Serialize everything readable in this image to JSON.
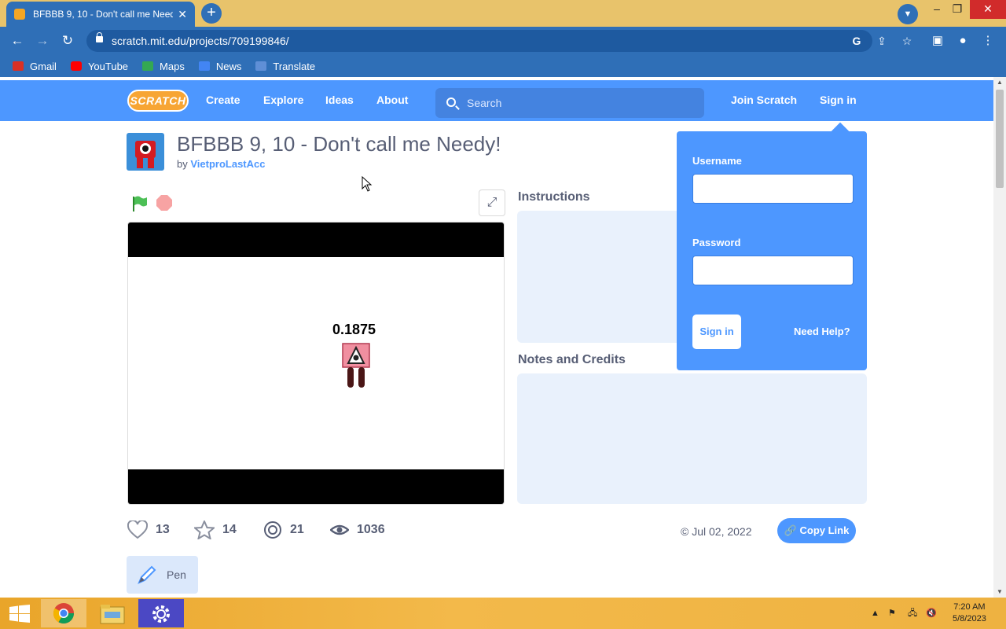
{
  "browser": {
    "tab_title": "BFBBB 9, 10 - Don't call me Needy!",
    "tab_close": "✕",
    "new_tab": "+",
    "url": "scratch.mit.edu/projects/709199846/",
    "window_controls": {
      "minimize": "–",
      "restore": "❐",
      "close": "✕"
    }
  },
  "bookmarks": [
    {
      "label": "Gmail",
      "icon": "gmail-icon",
      "color": "#d93025"
    },
    {
      "label": "YouTube",
      "icon": "youtube-icon",
      "color": "#ff0000"
    },
    {
      "label": "Maps",
      "icon": "maps-icon",
      "color": "#34a853"
    },
    {
      "label": "News",
      "icon": "news-icon",
      "color": "#4285f4"
    },
    {
      "label": "Translate",
      "icon": "translate-icon",
      "color": "#5f8fd6"
    }
  ],
  "scratch_nav": {
    "logo": "SCRATCH",
    "links": [
      "Create",
      "Explore",
      "Ideas",
      "About"
    ],
    "search_placeholder": "Search",
    "join": "Join Scratch",
    "signin": "Sign in"
  },
  "project": {
    "title": "BFBBB 9, 10 - Don't call me Needy!",
    "by_prefix": "by",
    "author": "VietproLastAcc",
    "stage_text": "0.1875",
    "instructions_heading": "Instructions",
    "notes_heading": "Notes and Credits",
    "stats": {
      "loves": "13",
      "favorites": "14",
      "remixes": "21",
      "views": "1036"
    },
    "date": "Jul 02, 2022",
    "copy_link": "Copy Link",
    "tag": "Pen"
  },
  "signin_popup": {
    "username_label": "Username",
    "password_label": "Password",
    "signin_button": "Sign in",
    "help_link": "Need Help?"
  },
  "taskbar": {
    "time": "7:20 AM",
    "date": "5/8/2023"
  },
  "colors": {
    "scratch_blue": "#4d97ff",
    "chrome_blue": "#2f6fb7",
    "title_bar": "#e8c36b"
  }
}
